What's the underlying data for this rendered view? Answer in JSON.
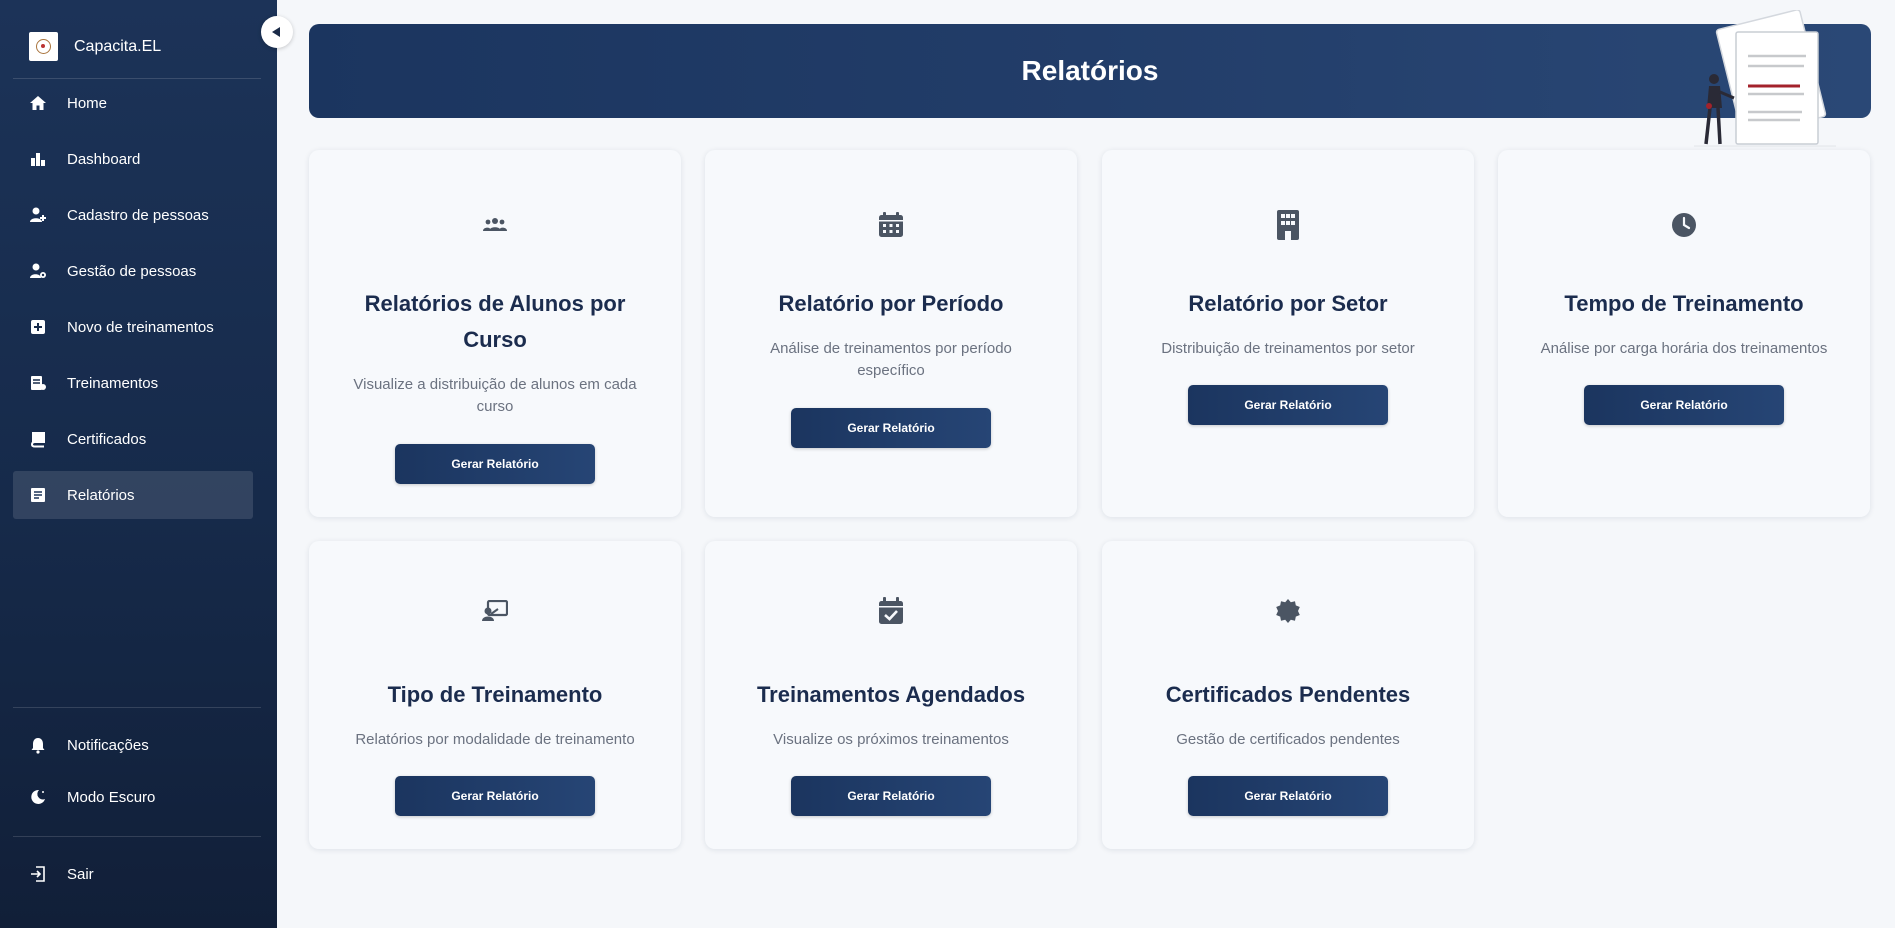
{
  "brand": {
    "name": "Capacita.EL"
  },
  "sidebar": {
    "items": [
      {
        "label": "Home",
        "icon": "home-icon"
      },
      {
        "label": "Dashboard",
        "icon": "bar-chart-icon"
      },
      {
        "label": "Cadastro de pessoas",
        "icon": "person-add-icon"
      },
      {
        "label": "Gestão de pessoas",
        "icon": "person-gear-icon"
      },
      {
        "label": "Novo de treinamentos",
        "icon": "plus-box-icon"
      },
      {
        "label": "Treinamentos",
        "icon": "training-icon"
      },
      {
        "label": "Certificados",
        "icon": "certificate-icon"
      },
      {
        "label": "Relatórios",
        "icon": "report-icon",
        "active": true
      }
    ],
    "bottom": [
      {
        "label": "Notificações",
        "icon": "bell-icon"
      },
      {
        "label": "Modo Escuro",
        "icon": "moon-icon"
      }
    ],
    "logout": {
      "label": "Sair",
      "icon": "logout-icon"
    }
  },
  "header": {
    "title": "Relatórios"
  },
  "cards": [
    {
      "title": "Relatórios de Alunos por Curso",
      "description": "Visualize a distribuição de alunos em cada curso",
      "button": "Gerar Relatório",
      "icon": "group-icon"
    },
    {
      "title": "Relatório por Período",
      "description": "Análise de treinamentos por período específico",
      "button": "Gerar Relatório",
      "icon": "calendar-icon"
    },
    {
      "title": "Relatório por Setor",
      "description": "Distribuição de treinamentos por setor",
      "button": "Gerar Relatório",
      "icon": "building-icon"
    },
    {
      "title": "Tempo de Treinamento",
      "description": "Análise por carga horária dos treinamentos",
      "button": "Gerar Relatório",
      "icon": "clock-icon"
    },
    {
      "title": "Tipo de Treinamento",
      "description": "Relatórios por modalidade de treinamento",
      "button": "Gerar Relatório",
      "icon": "presentation-icon"
    },
    {
      "title": "Treinamentos Agendados",
      "description": "Visualize os próximos treinamentos",
      "button": "Gerar Relatório",
      "icon": "calendar-check-icon"
    },
    {
      "title": "Certificados Pendentes",
      "description": "Gestão de certificados pendentes",
      "button": "Gerar Relatório",
      "icon": "badge-icon"
    }
  ],
  "colors": {
    "sidebar": "#162a4a",
    "accent": "#1b355f",
    "background": "#f5f7fa",
    "card_title": "#1b2c4e"
  }
}
